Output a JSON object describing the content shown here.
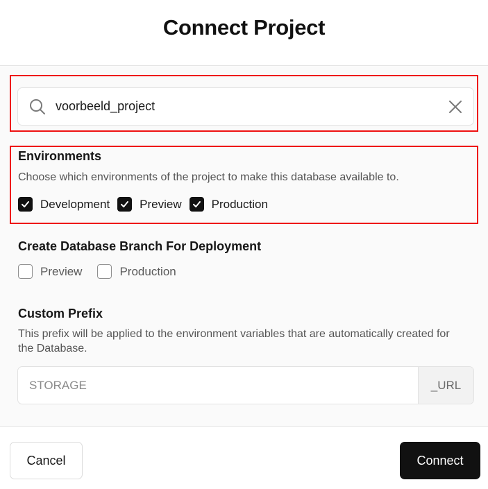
{
  "dialog": {
    "title": "Connect Project"
  },
  "search": {
    "value": "voorbeeld_project",
    "search_icon": "search-icon",
    "clear_icon": "close-icon"
  },
  "environments": {
    "title": "Environments",
    "description": "Choose which environments of the project to make this database available to.",
    "options": [
      {
        "label": "Development",
        "checked": true
      },
      {
        "label": "Preview",
        "checked": true
      },
      {
        "label": "Production",
        "checked": true
      }
    ]
  },
  "branch": {
    "title": "Create Database Branch For Deployment",
    "options": [
      {
        "label": "Preview",
        "checked": false
      },
      {
        "label": "Production",
        "checked": false
      }
    ]
  },
  "prefix": {
    "title": "Custom Prefix",
    "description": "This prefix will be applied to the environment variables that are automatically created for the Database.",
    "placeholder": "STORAGE",
    "suffix": "_URL"
  },
  "footer": {
    "cancel_label": "Cancel",
    "connect_label": "Connect"
  },
  "colors": {
    "highlight": "#ee1111",
    "primary": "#111111"
  }
}
